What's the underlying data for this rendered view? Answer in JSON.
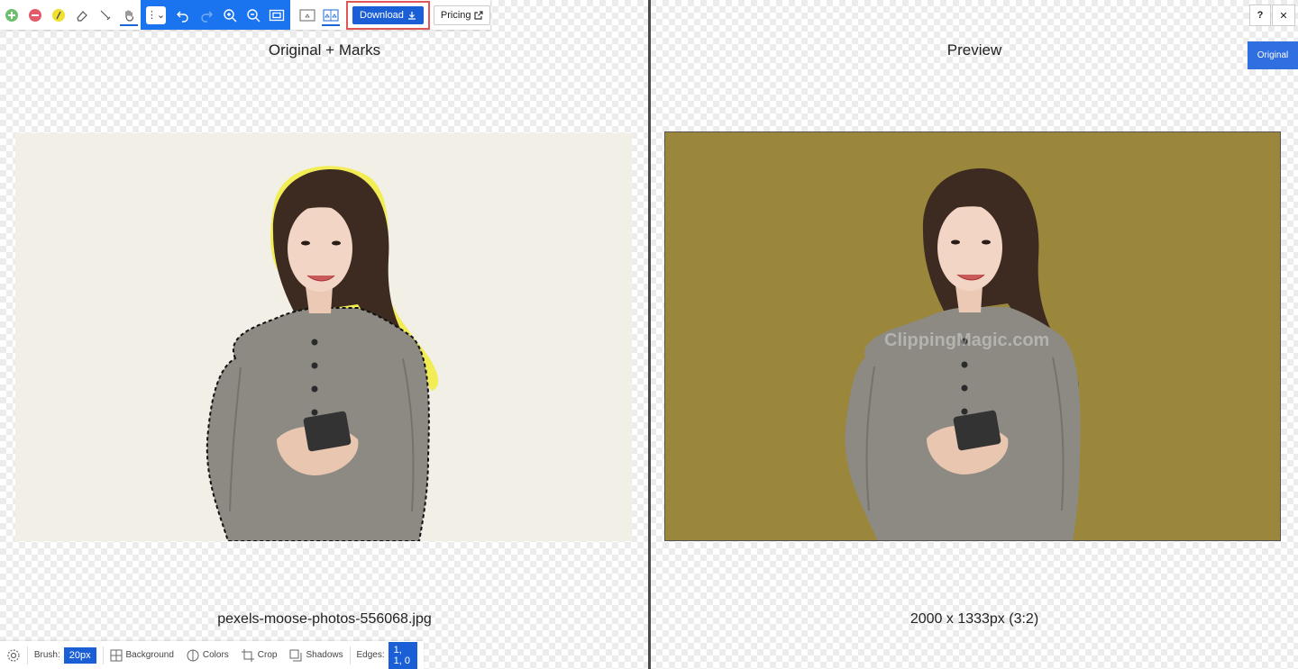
{
  "toolbar": {
    "tools": [
      {
        "name": "keep-icon",
        "color": "#6cc06c"
      },
      {
        "name": "remove-icon",
        "color": "#e35a6a"
      },
      {
        "name": "hair-brush-icon",
        "color": "#f0e030"
      },
      {
        "name": "eraser-icon"
      },
      {
        "name": "scalpel-icon"
      },
      {
        "name": "pan-hand-icon"
      }
    ],
    "mode_select_glyph": "⋮⌄",
    "download_label": "Download",
    "pricing_label": "Pricing"
  },
  "left_pane": {
    "title": "Original + Marks",
    "caption": "pexels-moose-photos-556068.jpg"
  },
  "right_pane": {
    "title": "Preview",
    "caption": "2000 x 1333px (3:2)",
    "watermark": "ClippingMagic.com",
    "original_button": "Original"
  },
  "top_right": {
    "help_label": "?",
    "close_label": "✕"
  },
  "bottombar": {
    "brush_label": "Brush:",
    "brush_value": "20px",
    "background_label": "Background",
    "colors_label": "Colors",
    "crop_label": "Crop",
    "shadows_label": "Shadows",
    "edges_label": "Edges:",
    "edges_value": "1, 1, 0"
  },
  "colors": {
    "accent": "#1a74f0",
    "preview_background": "#9a873b",
    "original_background": "#f2efe6"
  }
}
